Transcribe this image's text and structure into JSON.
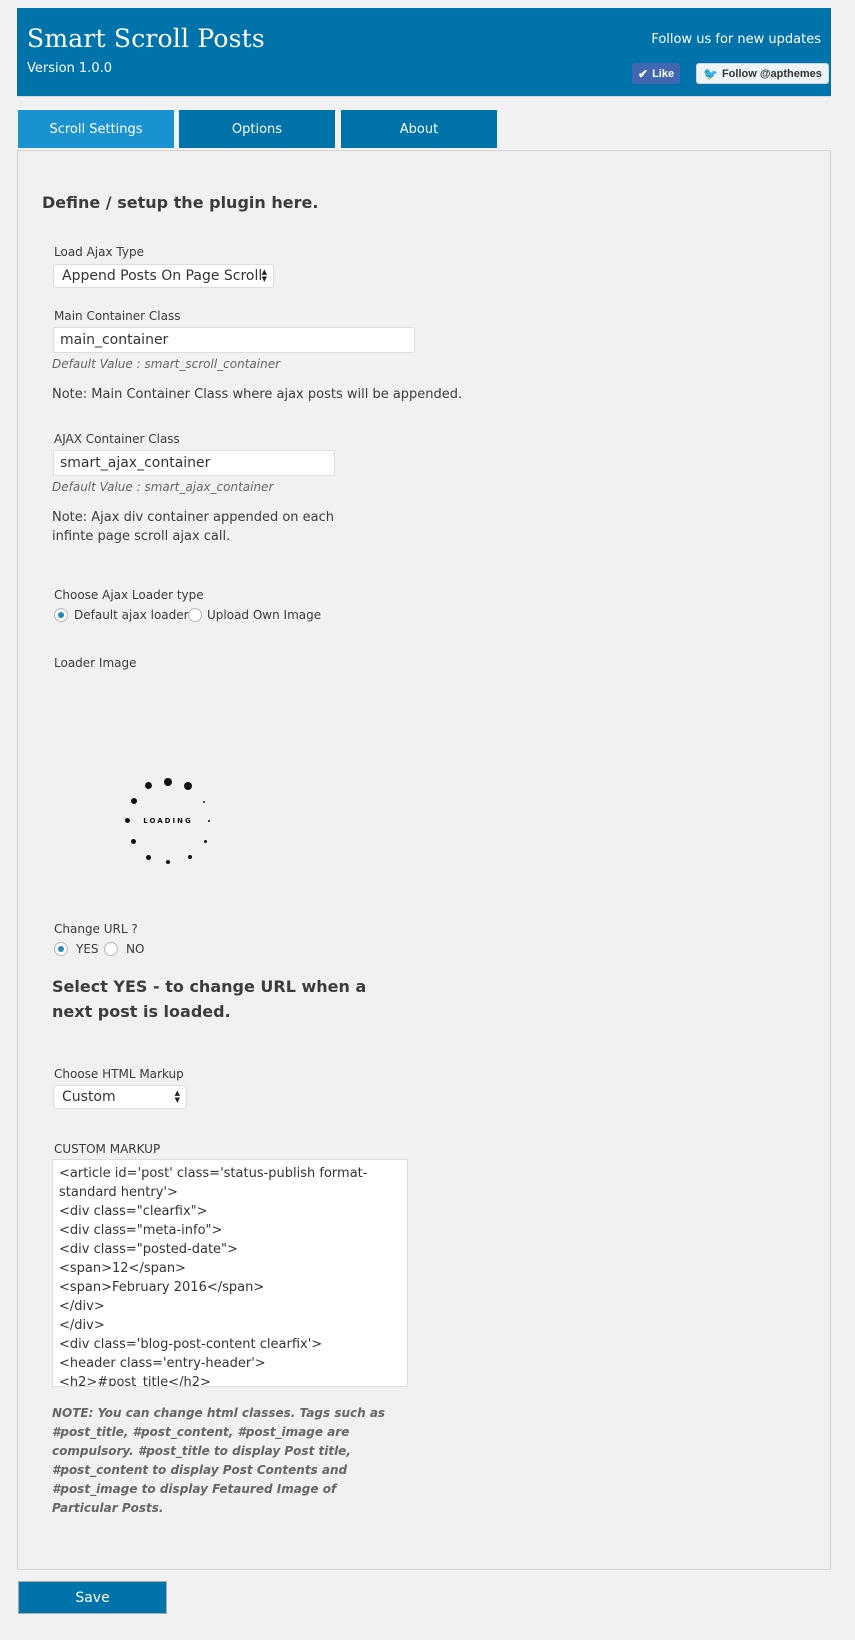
{
  "header": {
    "title": "Smart Scroll Posts",
    "version": "Version 1.0.0",
    "follow_text": "Follow us for new updates",
    "fb_like_label": "Like",
    "tw_follow_label": "Follow @apthemes"
  },
  "tabs": [
    {
      "label": "Scroll Settings",
      "active": true
    },
    {
      "label": "Options",
      "active": false
    },
    {
      "label": "About",
      "active": false
    }
  ],
  "settings": {
    "heading": "Define / setup the plugin here.",
    "load_ajax_type": {
      "label": "Load Ajax Type",
      "value": "Append Posts On Page Scroll"
    },
    "main_container": {
      "label": "Main Container Class",
      "value": "main_container",
      "default_hint": "Default Value : smart_scroll_container",
      "note": "Note: Main Container Class where ajax posts will be appended."
    },
    "ajax_container": {
      "label": "AJAX Container Class",
      "value": "smart_ajax_container",
      "default_hint": "Default Value : smart_ajax_container",
      "note_line1": "Note: Ajax div container appended on each",
      "note_line2": "infinte page scroll ajax call."
    },
    "loader_type": {
      "label": "Choose Ajax Loader type",
      "option_default": "Default ajax loader",
      "option_upload": "Upload Own Image",
      "selected": "default"
    },
    "loader_image": {
      "label": "Loader Image",
      "loading_text": "LOADING"
    },
    "change_url": {
      "label": "Change URL ?",
      "option_yes": "YES",
      "option_no": "NO",
      "selected": "yes",
      "note_line1": "Select YES - to change URL when a",
      "note_line2": "next post is loaded."
    },
    "html_markup": {
      "label": "Choose HTML Markup",
      "value": "Custom"
    },
    "custom_markup": {
      "label": "CUSTOM MARKUP",
      "value": "<article id='post' class='status-publish format-standard hentry'>\n<div class=\"clearfix\">\n<div class=\"meta-info\">\n<div class=\"posted-date\">\n<span>12</span>\n<span>February 2016</span>\n</div>\n</div>\n<div class='blog-post-content clearfix'>\n<header class='entry-header'>\n<h2>#post_title</h2>"
    },
    "markup_note": {
      "line1": "NOTE: You can change html classes. Tags such as",
      "line2": "#post_title, #post_content, #post_image are",
      "line3": "compulsory. #post_title to display Post title,",
      "line4": "#post_content to display Post Contents and",
      "line5": "#post_image to display Fetaured Image of",
      "line6": "Particular Posts."
    }
  },
  "save_label": "Save",
  "colors": {
    "primary": "#0073aa",
    "active_tab": "#1a92d0",
    "background": "#f1f1f1"
  }
}
